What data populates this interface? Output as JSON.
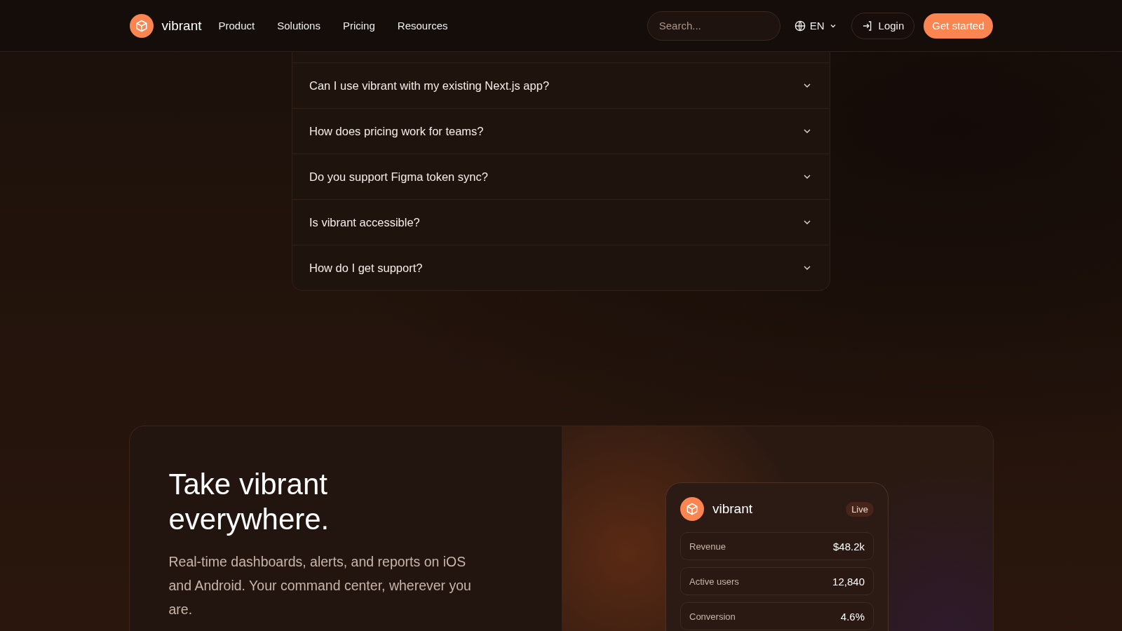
{
  "header": {
    "brand": "vibrant",
    "nav": [
      {
        "label": "Product"
      },
      {
        "label": "Solutions"
      },
      {
        "label": "Pricing"
      },
      {
        "label": "Resources"
      }
    ],
    "search": {
      "placeholder": "Search..."
    },
    "language": "EN",
    "login": "Login",
    "cta": "Get started"
  },
  "faq": [
    {
      "question": "Can I use vibrant with my existing Next.js app?",
      "expanded": false
    },
    {
      "question": "How does pricing work for teams?",
      "expanded": false
    },
    {
      "question": "Do you support Figma token sync?",
      "expanded": false
    },
    {
      "question": "Is vibrant accessible?",
      "expanded": false
    },
    {
      "question": "How do I get support?",
      "expanded": false
    }
  ],
  "promo": {
    "title": "Take vibrant everywhere.",
    "text": "Real-time dashboards, alerts, and reports on iOS and Android. Your command center, wherever you are.",
    "phone": {
      "brand": "vibrant",
      "badge": "Live",
      "metrics": [
        {
          "label": "Revenue",
          "value": "$48.2k"
        },
        {
          "label": "Active users",
          "value": "12,840"
        },
        {
          "label": "Conversion",
          "value": "4.6%"
        }
      ]
    }
  }
}
